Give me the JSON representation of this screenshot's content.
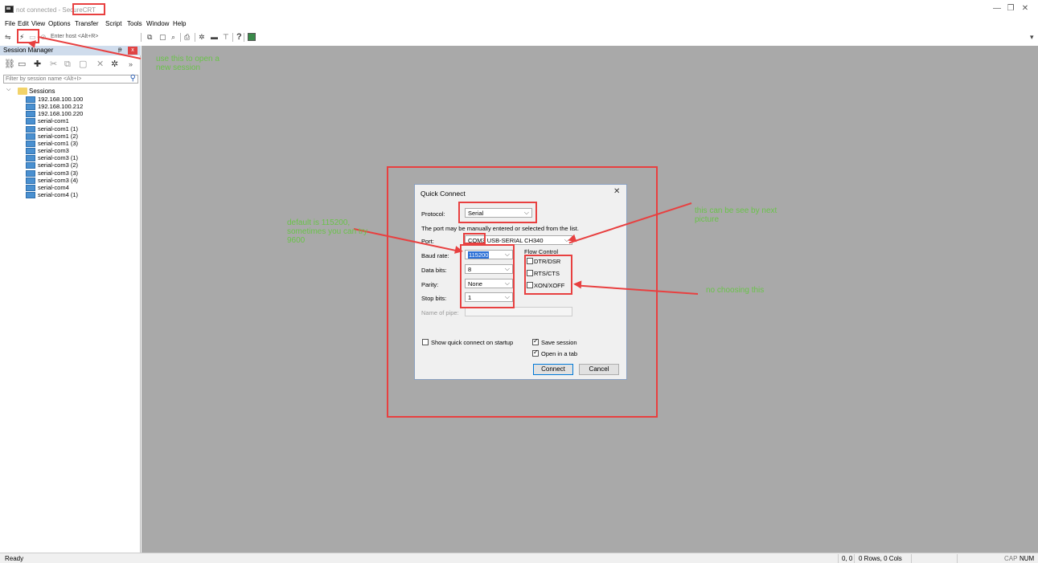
{
  "window": {
    "title_prefix": "not connected - ",
    "title_app": "SecureCRT",
    "min": "—",
    "restore": "❐",
    "close": "✕"
  },
  "menu": [
    "File",
    "Edit",
    "View",
    "Options",
    "Transfer",
    "Script",
    "Tools",
    "Window",
    "Help"
  ],
  "toolbar": {
    "host_placeholder": "Enter host <Alt+R>"
  },
  "session_manager": {
    "title": "Session Manager",
    "pin": "ᵽ",
    "close": "x",
    "filter_placeholder": "Filter by session name <Alt+I>",
    "root_label": "Sessions",
    "sessions": [
      "192.168.100.100",
      "192.168.100.212",
      "192.168.100.220",
      "serial-com1",
      "serial-com1 (1)",
      "serial-com1 (2)",
      "serial-com1 (3)",
      "serial-com3",
      "serial-com3 (1)",
      "serial-com3 (2)",
      "serial-com3 (3)",
      "serial-com3 (4)",
      "serial-com4",
      "serial-com4 (1)"
    ]
  },
  "dialog": {
    "title": "Quick Connect",
    "close": "✕",
    "protocol_label": "Protocol:",
    "protocol_value": "Serial",
    "port_hint": "The port may be manually entered or selected from the list.",
    "port_label": "Port:",
    "port_value_highlight": "COM3",
    "port_value_rest": "USB-SERIAL CH340",
    "baud_label": "Baud rate:",
    "baud_value": "115200",
    "databits_label": "Data bits:",
    "databits_value": "8",
    "parity_label": "Parity:",
    "parity_value": "None",
    "stopbits_label": "Stop bits:",
    "stopbits_value": "1",
    "pipe_label": "Name of pipe:",
    "flow_control_label": "Flow Control",
    "flow_options": [
      {
        "label": "DTR/DSR",
        "checked": false
      },
      {
        "label": "RTS/CTS",
        "checked": false
      },
      {
        "label": "XON/XOFF",
        "checked": false
      }
    ],
    "show_on_startup_label": "Show quick connect on startup",
    "save_session_label": "Save session",
    "open_in_tab_label": "Open in a tab",
    "connect_label": "Connect",
    "cancel_label": "Cancel"
  },
  "annotations": {
    "new_session_note": [
      "use this to open a",
      "new session"
    ],
    "baud_note": [
      "default is 115200,",
      "sometimes you can try",
      "9600"
    ],
    "port_note": [
      "this can be see by next",
      "picture"
    ],
    "flow_note": "no choosing this"
  },
  "status": {
    "ready": "Ready",
    "position": "0, 0",
    "rows_cols": "0 Rows, 0 Cols",
    "cap": "CAP",
    "num": "NUM"
  },
  "colors": {
    "annotation_red": "#e84040",
    "annotation_green": "#6ac24a",
    "workspace_gray": "#a9a9a9"
  }
}
